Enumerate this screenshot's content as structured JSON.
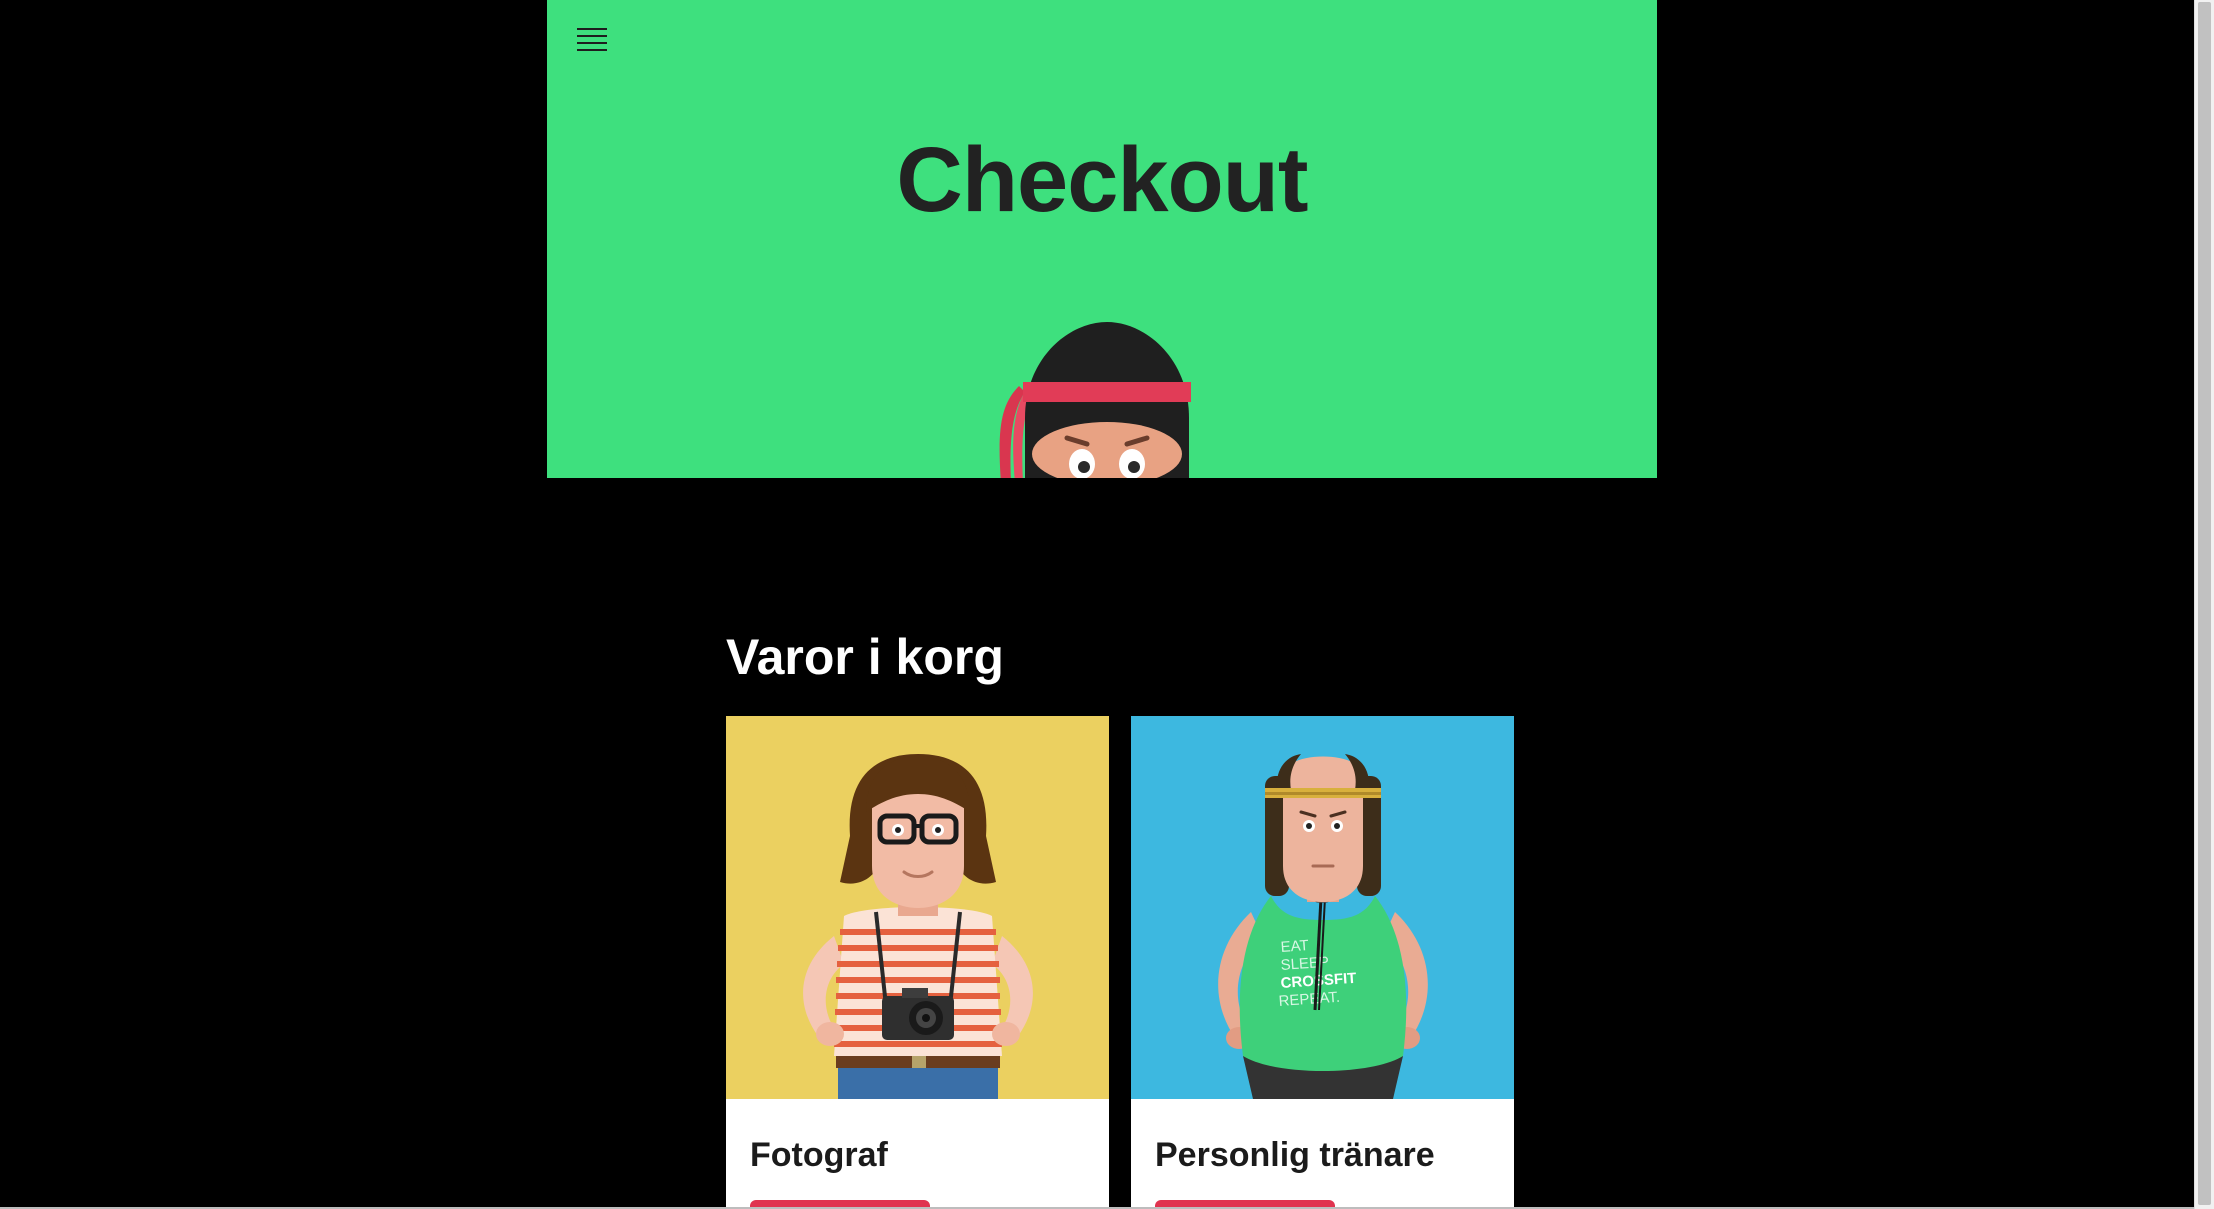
{
  "hero": {
    "title": "Checkout",
    "background_color": "#3ee07e",
    "menu_icon": "hamburger-menu-icon",
    "mascot": "ninja-mascot"
  },
  "cart": {
    "heading": "Varor i korg",
    "items": [
      {
        "title": "Fotograf",
        "image_background": "#ebd060",
        "illustration": "photographer-character"
      },
      {
        "title": "Personlig tränare",
        "image_background": "#3db8e0",
        "illustration": "personal-trainer-character"
      }
    ]
  },
  "trainer_shirt": {
    "line1": "EAT",
    "line2": "SLEEP",
    "line3": "CROSSFIT",
    "line4": "REPEAT."
  },
  "colors": {
    "page_background": "#000000",
    "accent_red": "#e0334f"
  }
}
